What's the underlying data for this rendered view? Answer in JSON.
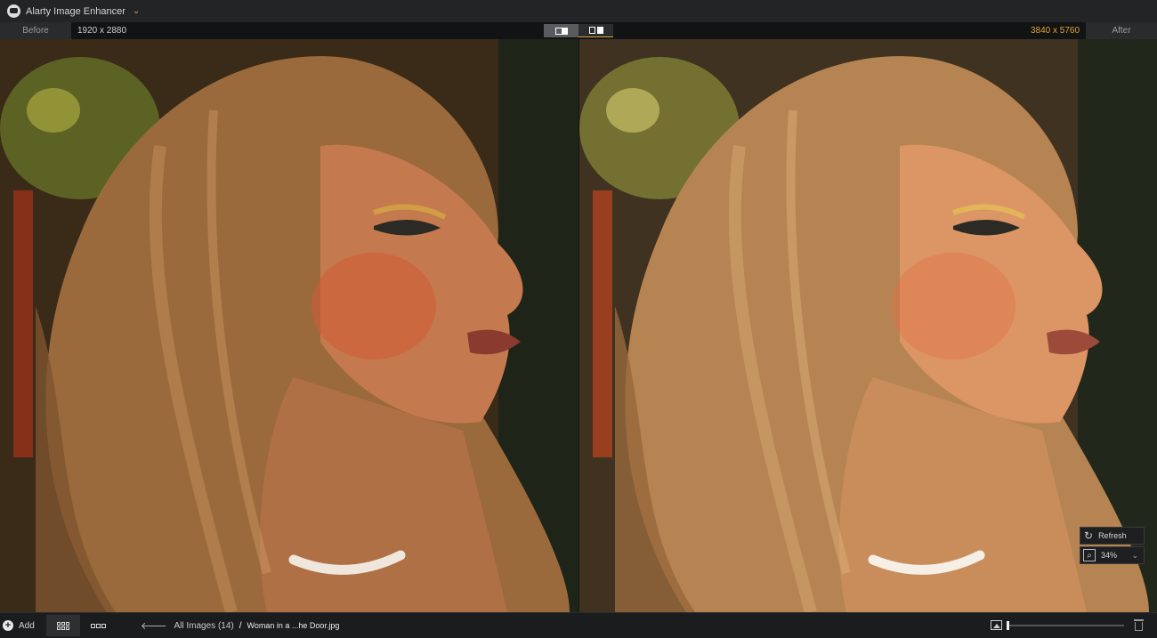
{
  "app": {
    "title": "Alarty Image Enhancer",
    "chevron": "⌄"
  },
  "compare": {
    "before_label": "Before",
    "before_size": "1920 x 2880",
    "after_label": "After",
    "after_size": "3840 x 5760",
    "accent": "#e0a33a"
  },
  "preview": {
    "refresh_label": "Refresh",
    "zoom": "34%"
  },
  "bottom": {
    "add_label": "Add",
    "breadcrumb_root": "All Images (14)",
    "breadcrumb_sep": "/",
    "filename": "Woman in a ...he Door.jpg"
  },
  "icons": [
    "app-logo-icon",
    "chevron-down-icon",
    "split-view-icon",
    "side-by-side-icon",
    "refresh-icon",
    "zoom-icon",
    "add-icon",
    "grid-view-icon",
    "strip-view-icon",
    "back-arrow-icon",
    "image-icon",
    "trash-icon"
  ]
}
